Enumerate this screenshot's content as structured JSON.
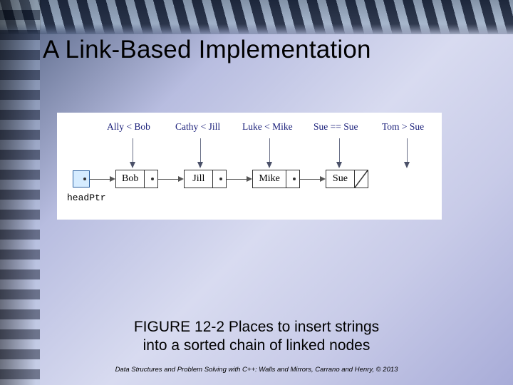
{
  "title": "A Link-Based Implementation",
  "headPtrLabel": "headPtr",
  "comparisons": [
    {
      "text": "Ally < Bob"
    },
    {
      "text": "Cathy < Jill"
    },
    {
      "text": "Luke < Mike"
    },
    {
      "text": "Sue == Sue"
    },
    {
      "text": "Tom > Sue"
    }
  ],
  "nodes": [
    {
      "label": "Bob",
      "null": false
    },
    {
      "label": "Jill",
      "null": false
    },
    {
      "label": "Mike",
      "null": false
    },
    {
      "label": "Sue",
      "null": true
    }
  ],
  "caption_line1": "FIGURE 12-2 Places to insert strings",
  "caption_line2": "into a sorted chain of linked nodes",
  "credit": "Data Structures and Problem Solving with C++: Walls and Mirrors, Carrano and Henry, ©  2013"
}
